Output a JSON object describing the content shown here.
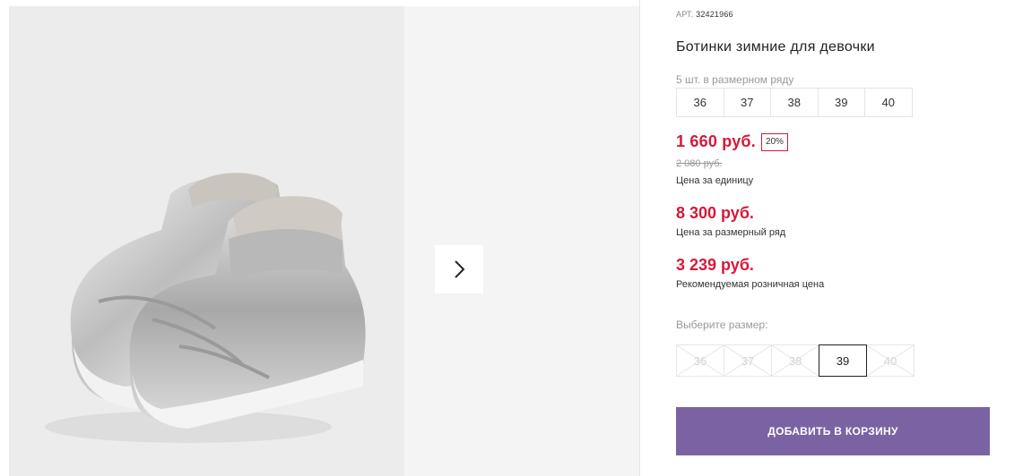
{
  "product": {
    "art_label": "АРТ.",
    "art_number": "32421966",
    "title": "Ботинки зимние для девочки",
    "run_label": "5 шт. в размерном ряду",
    "run_sizes": [
      "36",
      "37",
      "38",
      "39",
      "40"
    ],
    "price": "1 660 руб.",
    "discount_badge": "20%",
    "old_price": "2 080 руб.",
    "unit_price_label": "Цена за единицу",
    "run_price": "8 300 руб.",
    "run_price_label": "Цена за размерный ряд",
    "retail_price": "3 239 руб.",
    "retail_price_label": "Рекомендуемая розничная цена",
    "choose_size_label": "Выберите размер:",
    "sizes": [
      {
        "label": "36",
        "available": false
      },
      {
        "label": "37",
        "available": false
      },
      {
        "label": "38",
        "available": false
      },
      {
        "label": "39",
        "available": true,
        "selected": true
      },
      {
        "label": "40",
        "available": false
      }
    ],
    "add_to_cart_label": "ДОБАВИТЬ В КОРЗИНУ"
  },
  "gallery": {
    "next_icon": "chevron-right-icon"
  },
  "colors": {
    "price_red": "#d6183a",
    "cart_purple": "#7b63a3"
  }
}
